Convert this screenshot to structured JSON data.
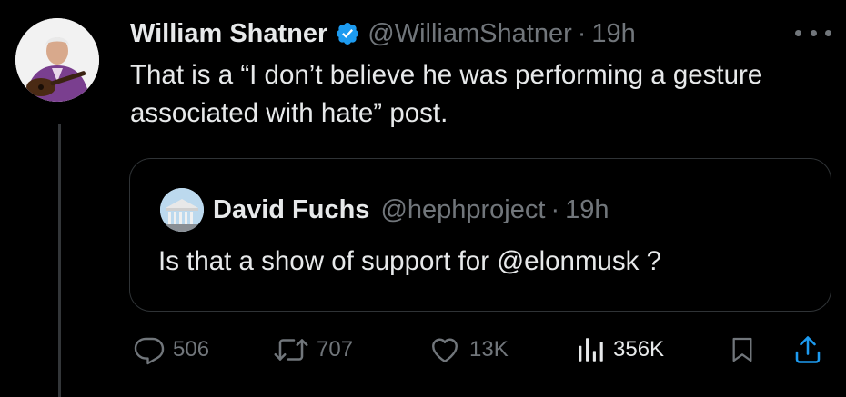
{
  "author": {
    "display_name": "William Shatner",
    "handle": "@WilliamShatner",
    "separator": "·",
    "time": "19h"
  },
  "tweet": {
    "text": "That is a “I don’t believe he was performing a gesture associated with hate” post."
  },
  "quoted_tweet": {
    "display_name": "David Fuchs",
    "handle": "@hephproject",
    "separator": "·",
    "time": "19h",
    "text": "Is that a show of support for @elonmusk ?"
  },
  "actions": {
    "replies": "506",
    "reposts": "707",
    "likes": "13K",
    "views": "356K"
  },
  "icons": {
    "verified": "verified-badge-icon",
    "more": "more-icon",
    "reply": "reply-icon",
    "repost": "repost-icon",
    "like": "like-icon",
    "views": "views-icon",
    "bookmark": "bookmark-icon",
    "share": "share-icon"
  },
  "colors": {
    "background": "#000000",
    "text_primary": "#e7e9ea",
    "text_secondary": "#71767b",
    "verified_blue": "#1d9bf0",
    "border": "#2f3336"
  }
}
